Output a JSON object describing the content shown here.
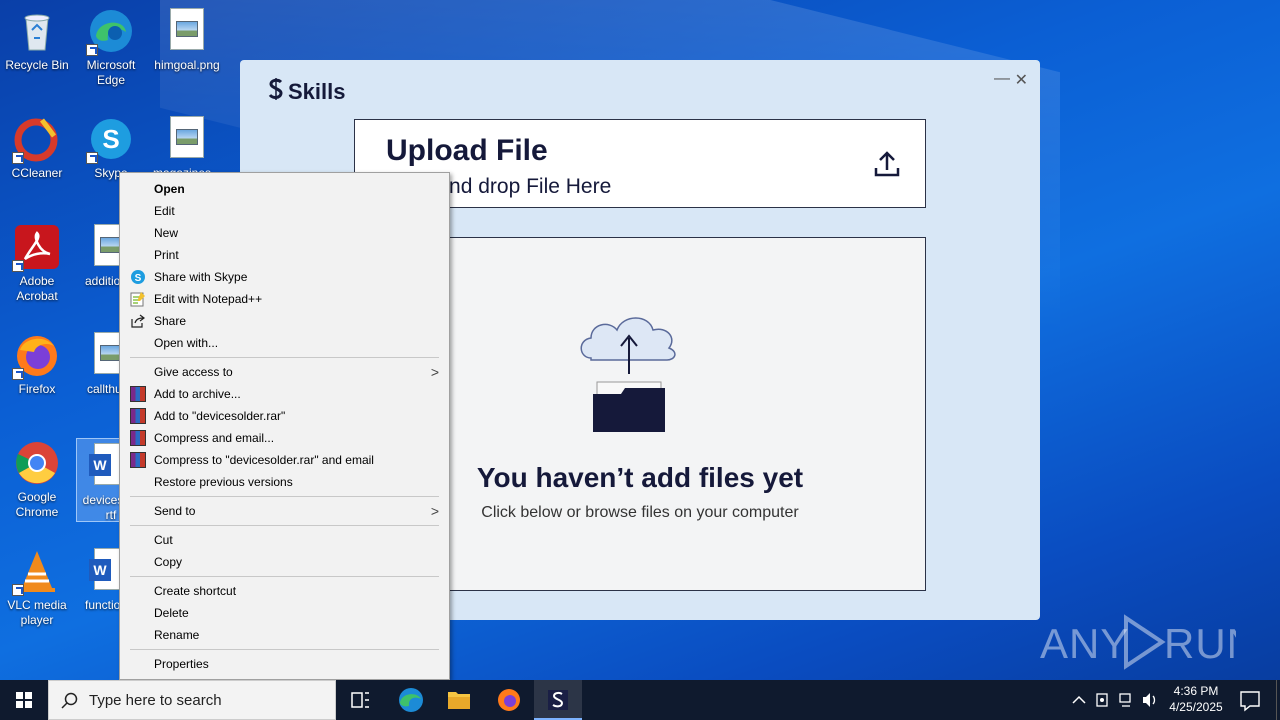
{
  "desktop": {
    "icons": [
      {
        "label": "Recycle Bin"
      },
      {
        "label": "Microsoft Edge"
      },
      {
        "label": "himgoal.png"
      },
      {
        "label": "CCleaner"
      },
      {
        "label": "Skype"
      },
      {
        "label": "magazines..."
      },
      {
        "label": "Adobe Acrobat"
      },
      {
        "label": "addition..."
      },
      {
        "label": "Firefox"
      },
      {
        "label": "callthur..."
      },
      {
        "label": "Google Chrome"
      },
      {
        "label": "devicesold rtf"
      },
      {
        "label": "VLC media player"
      },
      {
        "label": "function..."
      }
    ]
  },
  "skills_window": {
    "logo_text": "Skills",
    "upload_title": "Upload File",
    "upload_subtitle": "Drag and drop File Here",
    "empty_title": "You haven’t add files yet",
    "empty_subtitle": "Click below or browse files on your computer"
  },
  "context_menu": {
    "items": [
      {
        "label": "Open"
      },
      {
        "label": "Edit"
      },
      {
        "label": "New"
      },
      {
        "label": "Print"
      },
      {
        "label": "Share with Skype"
      },
      {
        "label": "Edit with Notepad++"
      },
      {
        "label": "Share"
      },
      {
        "label": "Open with..."
      },
      {
        "label": "Give access to"
      },
      {
        "label": "Add to archive..."
      },
      {
        "label": "Add to \"devicesolder.rar\""
      },
      {
        "label": "Compress and email..."
      },
      {
        "label": "Compress to \"devicesolder.rar\" and email"
      },
      {
        "label": "Restore previous versions"
      },
      {
        "label": "Send to"
      },
      {
        "label": "Cut"
      },
      {
        "label": "Copy"
      },
      {
        "label": "Create shortcut"
      },
      {
        "label": "Delete"
      },
      {
        "label": "Rename"
      },
      {
        "label": "Properties"
      }
    ]
  },
  "taskbar": {
    "search_placeholder": "Type here to search",
    "time": "4:36 PM",
    "date": "4/25/2025"
  },
  "watermark": "ANY RUN"
}
